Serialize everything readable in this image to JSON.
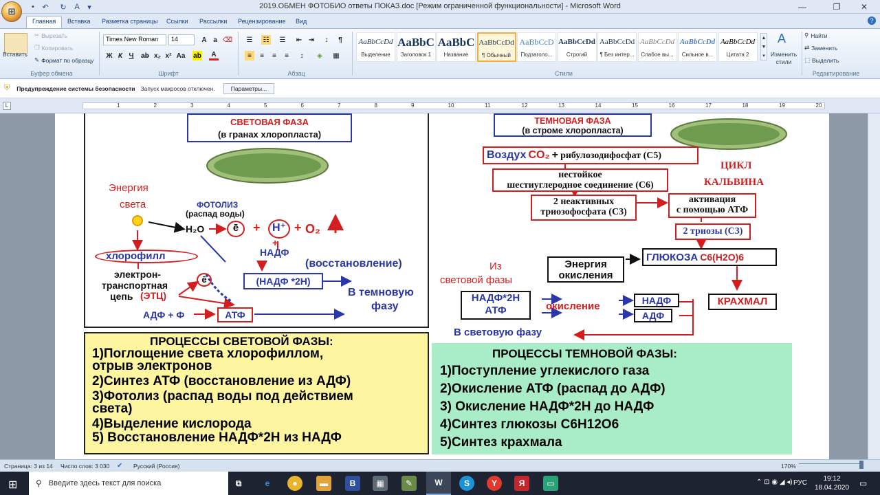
{
  "window": {
    "title": "2019.ОБМЕН ФОТОБИО ответы ПОКАЗ.doc [Режим ограниченной функциональности] - Microsoft Word"
  },
  "tabs": [
    "Главная",
    "Вставка",
    "Разметка страницы",
    "Ссылки",
    "Рассылки",
    "Рецензирование",
    "Вид"
  ],
  "ribbon": {
    "clipboard": {
      "paste": "Вставить",
      "cut": "Вырезать",
      "copy": "Копировать",
      "format_painter": "Формат по образцу",
      "label": "Буфер обмена"
    },
    "font": {
      "name": "Times New Roman",
      "size": "14",
      "label": "Шрифт"
    },
    "paragraph": {
      "label": "Абзац"
    },
    "styles": {
      "items": [
        {
          "preview": "AaBbCcDd",
          "name": "Выделение"
        },
        {
          "preview": "AaBbC",
          "name": "Заголовок 1"
        },
        {
          "preview": "AaBbC",
          "name": "Название"
        },
        {
          "preview": "AaBbCcDd",
          "name": "¶ Обычный"
        },
        {
          "preview": "AaBbCcD",
          "name": "Подзаголо..."
        },
        {
          "preview": "AaBbCcDd",
          "name": "Строгий"
        },
        {
          "preview": "AaBbCcDd",
          "name": "¶ Без интер..."
        },
        {
          "preview": "AaBbCcDd",
          "name": "Слабое вы..."
        },
        {
          "preview": "AaBbCcDd",
          "name": "Сильное в..."
        },
        {
          "preview": "AaBbCcDd",
          "name": "Цитата 2"
        }
      ],
      "change": "Изменить стили",
      "label": "Стили"
    },
    "editing": {
      "find": "Найти",
      "replace": "Заменить",
      "select": "Выделить",
      "label": "Редактирование"
    }
  },
  "security": {
    "title": "Предупреждение системы безопасности",
    "message": "Запуск макросов отключен.",
    "button": "Параметры..."
  },
  "ruler": [
    "1",
    "2",
    "3",
    "4",
    "5",
    "6",
    "7",
    "8",
    "9",
    "10",
    "11",
    "12",
    "13",
    "14",
    "15",
    "16",
    "17",
    "18",
    "19",
    "20"
  ],
  "diagram": {
    "light": {
      "title1": "СВЕТОВАЯ ФАЗА",
      "title2": "(в гранах хлоропласта)",
      "energy1": "Энергия",
      "energy2": "света",
      "photolysis": "ФОТОЛИЗ",
      "water_split": "(распад воды)",
      "h2o": "H₂O",
      "e": "ē",
      "plus": "+",
      "hplus": "H⁺",
      "o2": "O₂",
      "nadp": "НАДФ",
      "reduction": "(восстановление)",
      "nadph": "(НАДФ *2Н)",
      "chlorophyll": "хлорофилл",
      "etc1": "электрон-",
      "etc2": "транспортная",
      "etc3": "цепь",
      "etc_abbr": "(ЭТЦ)",
      "adp": "АДФ + Ф",
      "atp": "АТФ",
      "to_dark1": "В темновую",
      "to_dark2": "фазу"
    },
    "dark": {
      "title1": "ТЕМНОВАЯ ФАЗА",
      "title2": "(в строме хлоропласта)",
      "air": "Воздух",
      "co2": "CO₂",
      "plus": "+",
      "rubp": "рибулозодифосфат (С5)",
      "calvin1": "ЦИКЛ",
      "calvin2": "КАЛЬВИНА",
      "unstable1": "нестойкое",
      "unstable2": "шестиуглеродное соединение (С6)",
      "inactive1": "2 неактивных",
      "inactive2": "триозофосфата (С3)",
      "activation1": "активация",
      "activation2": "с помощью АТФ",
      "trioses": "2 триозы (С3)",
      "glucose": "ГЛЮКОЗА",
      "glucose_formula": "С6(H2O)6",
      "energy1": "Энергия",
      "energy2": "окисления",
      "from_light1": "Из",
      "from_light2": "световой фазы",
      "nadph": "НАДФ*2Н",
      "atp": "АТФ",
      "oxidation": "окисление",
      "nadp": "НАДФ",
      "adp": "АДФ",
      "starch": "КРАХМАЛ",
      "to_light": "В световую фазу"
    }
  },
  "processes_light": {
    "title": "ПРОЦЕССЫ СВЕТОВОЙ ФАЗЫ:",
    "lines": [
      "1)Поглощение света хлорофиллом,",
      "отрыв электронов",
      "2)Синтез АТФ (восстановление из АДФ)",
      "3)Фотолиз (распад воды  под действием",
      "света)",
      "4)Выделение кислорода",
      "5) Восстановление НАДФ*2Н из НАДФ"
    ]
  },
  "processes_dark": {
    "title": "ПРОЦЕССЫ ТЕМНОВОЙ ФАЗЫ:",
    "lines": [
      "1)Поступление углекислого газа",
      "2)Окисление АТФ  (распад до АДФ)",
      "3) Окисление  НАДФ*2Н до НАДФ",
      "4)Синтез глюкозы С6Н12О6",
      "5)Синтез крахмала"
    ]
  },
  "status": {
    "page": "Страница: 3 из 14",
    "words": "Число слов: 3 030",
    "lang": "Русский (Россия)",
    "zoom": "170%"
  },
  "taskbar": {
    "search": "Введите здесь текст для поиска",
    "lang": "РУС",
    "time": "19:12",
    "date": "18.04.2020"
  },
  "colors": {
    "accent": "#2b579a",
    "red": "#d21e1e",
    "blue": "#2a37a8",
    "yellow": "#fdf5a0",
    "green": "#a8ecc8"
  }
}
